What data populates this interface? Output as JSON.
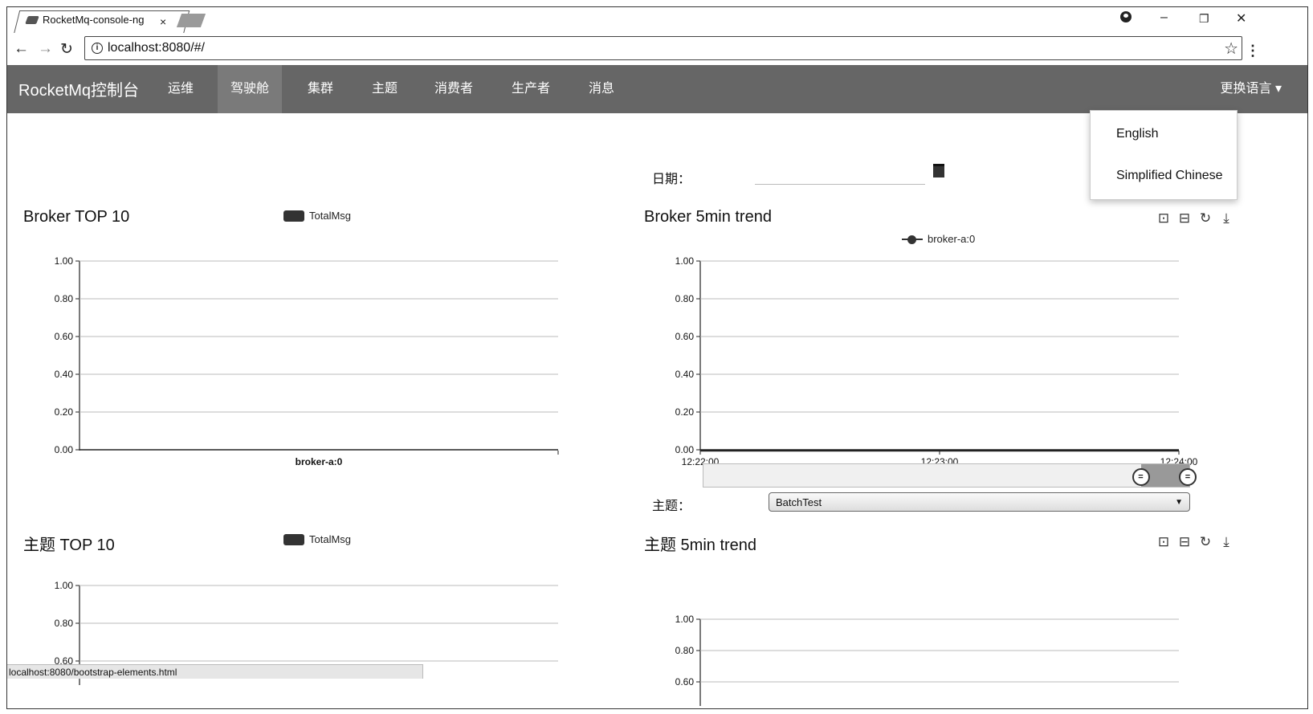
{
  "browser": {
    "tab_title": "RocketMq-console-ng",
    "tab_close": "×",
    "url": "localhost:8080/#/",
    "status_url": "localhost:8080/bootstrap-elements.html"
  },
  "navbar": {
    "brand": "RocketMq控制台",
    "items": [
      "运维",
      "驾驶舱",
      "集群",
      "主题",
      "消费者",
      "生产者",
      "消息"
    ],
    "active_item": "驾驶舱",
    "lang_toggle": "更换语言 ▾",
    "lang_options": [
      "English",
      "Simplified Chinese"
    ]
  },
  "filters": {
    "date_label": "日期：",
    "date_value": "",
    "topic_label": "主题：",
    "topic_selected": "BatchTest"
  },
  "panels": {
    "broker_top": {
      "title": "Broker TOP 10",
      "legend": "TotalMsg"
    },
    "broker_trend": {
      "title": "Broker 5min trend",
      "legend": "broker-a:0"
    },
    "topic_top": {
      "title": "主题 TOP 10",
      "legend": "TotalMsg"
    },
    "topic_trend": {
      "title": "主题 5min trend"
    }
  },
  "icons": {
    "toolbox": [
      "zoom-icon",
      "zoom-reset-icon",
      "restore-icon",
      "save-icon"
    ]
  },
  "chart_data": [
    {
      "type": "bar",
      "title": "Broker TOP 10",
      "categories": [
        "broker-a:0"
      ],
      "series": [
        {
          "name": "TotalMsg",
          "values": [
            0
          ]
        }
      ],
      "ylim": [
        0,
        1
      ],
      "yticks": [
        "0.00",
        "0.20",
        "0.40",
        "0.60",
        "0.80",
        "1.00"
      ],
      "grid": true,
      "legend": "top-center"
    },
    {
      "type": "line",
      "title": "Broker 5min trend",
      "x": [
        "12:22:00",
        "12:23:00",
        "12:24:00"
      ],
      "series": [
        {
          "name": "broker-a:0",
          "values": [
            0,
            0,
            0
          ]
        }
      ],
      "ylim": [
        0,
        1
      ],
      "yticks": [
        "0.00",
        "0.20",
        "0.40",
        "0.60",
        "0.80",
        "1.00"
      ],
      "grid": true,
      "legend": "top-center",
      "zoom_window": [
        0.9,
        1.0
      ]
    },
    {
      "type": "bar",
      "title": "主题 TOP 10",
      "series": [
        {
          "name": "TotalMsg",
          "values": []
        }
      ],
      "ylim": [
        0,
        1
      ],
      "yticks": [
        "0.60",
        "0.80",
        "1.00"
      ],
      "grid": true,
      "legend": "top-center"
    },
    {
      "type": "line",
      "title": "主题 5min trend",
      "series": [],
      "ylim": [
        0,
        1
      ],
      "yticks": [
        "0.60",
        "0.80",
        "1.00"
      ],
      "grid": true
    }
  ]
}
